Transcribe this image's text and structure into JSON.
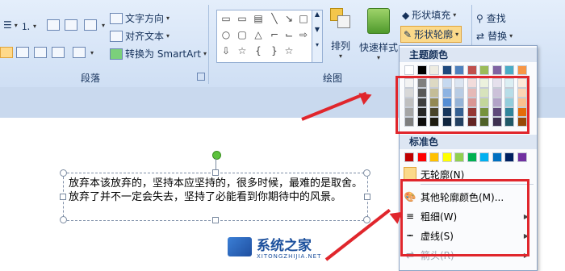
{
  "ribbon": {
    "paragraph": {
      "text_direction": "文字方向",
      "align_text": "对齐文本",
      "convert_smartart": "转换为 SmartArt",
      "group_label": "段落"
    },
    "drawing": {
      "arrange": "排列",
      "quick_styles": "快速样式",
      "shape_fill": "形状填充",
      "shape_outline": "形状轮廓",
      "group_label": "绘图"
    },
    "editing": {
      "find": "查找",
      "replace": "替换"
    }
  },
  "menu": {
    "theme_colors_label": "主题颜色",
    "standard_colors_label": "标准色",
    "items": [
      {
        "label": "无轮廓(N)"
      },
      {
        "label": "其他轮廓颜色(M)..."
      },
      {
        "label": "粗细(W)"
      },
      {
        "label": "虚线(S)"
      },
      {
        "label": "箭头(R)"
      }
    ],
    "theme_top_row": [
      "#ffffff",
      "#000000",
      "#eeece1",
      "#1f497d",
      "#4f81bd",
      "#c0504d",
      "#9bbb59",
      "#8064a2",
      "#4bacc6",
      "#f79646"
    ],
    "theme_shades": [
      [
        "#f2f2f2",
        "#7f7f7f",
        "#ddd9c3",
        "#c6d9f0",
        "#dbe5f1",
        "#f2dcdb",
        "#ebf1dd",
        "#e5e0ec",
        "#dbeef3",
        "#fdeada"
      ],
      [
        "#d8d8d8",
        "#595959",
        "#c4bd97",
        "#8db3e2",
        "#b8cce4",
        "#e5b9b7",
        "#d7e3bc",
        "#ccc1d9",
        "#b7dde8",
        "#fbd5b5"
      ],
      [
        "#bfbfbf",
        "#3f3f3f",
        "#938953",
        "#548dd4",
        "#95b3d7",
        "#d99694",
        "#c3d69b",
        "#b2a2c7",
        "#92cddc",
        "#fac08f"
      ],
      [
        "#a5a5a5",
        "#262626",
        "#494429",
        "#17365d",
        "#366092",
        "#953734",
        "#76923c",
        "#5f497a",
        "#31859b",
        "#e36c09"
      ],
      [
        "#7f7f7f",
        "#0c0c0c",
        "#1d1b10",
        "#0f243e",
        "#244061",
        "#632423",
        "#4f6128",
        "#3f3151",
        "#205867",
        "#974806"
      ]
    ],
    "standard": [
      "#c00000",
      "#ff0000",
      "#ffc000",
      "#ffff00",
      "#92d050",
      "#00b050",
      "#00b0f0",
      "#0070c0",
      "#002060",
      "#7030a0"
    ]
  },
  "textbox": {
    "text": "放弃本该放弃的，坚持本应坚持的，很多时候，最难的是取舍。放弃了并不一定会失去，坚持了必能看到你期待中的风景。"
  },
  "watermark": {
    "title": "系统之家",
    "url": "XITONGZHIJIA.NET"
  },
  "annotation_color": "#e0262c"
}
